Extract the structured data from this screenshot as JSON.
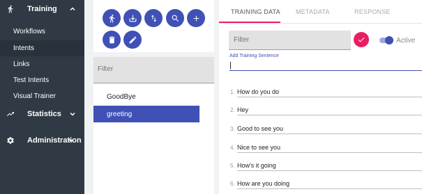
{
  "sidebar": {
    "training": {
      "label": "Training",
      "icon": "walk-icon",
      "chevron": "chevron-up-icon"
    },
    "items": [
      {
        "label": "Workflows"
      },
      {
        "label": "Intents",
        "active": true
      },
      {
        "label": "Links"
      },
      {
        "label": "Test Intents"
      },
      {
        "label": "Visual Trainer"
      }
    ],
    "statistics": {
      "label": "Statistics",
      "icon": "trending-up-icon",
      "chevron": "chevron-down-icon"
    },
    "administration": {
      "label": "Administration",
      "icon": "gear-icon",
      "chevron": "chevron-down-icon"
    }
  },
  "toolbar": {
    "buttons": [
      "walk-icon",
      "download-icon",
      "sort-icon",
      "search-icon",
      "add-icon",
      "delete-icon",
      "edit-icon"
    ]
  },
  "intents": {
    "filter_placeholder": "Filter",
    "items": [
      {
        "label": "GoodBye",
        "selected": false
      },
      {
        "label": "greeting",
        "selected": true
      }
    ]
  },
  "tabs": [
    {
      "label": "TRAINING DATA",
      "active": true
    },
    {
      "label": "METADATA",
      "active": false
    },
    {
      "label": "RESPONSE",
      "active": false
    }
  ],
  "training": {
    "filter_placeholder": "Filter",
    "active_label": "Active",
    "active": true,
    "add_label": "Add Training Sentence",
    "add_value": "",
    "sentences": [
      {
        "num": "1.",
        "text": "How do you do"
      },
      {
        "num": "2.",
        "text": "Hey"
      },
      {
        "num": "3.",
        "text": "Good to see you"
      },
      {
        "num": "4.",
        "text": "Nice to see you"
      },
      {
        "num": "5.",
        "text": "How's it going"
      },
      {
        "num": "6.",
        "text": "How are you doing"
      }
    ]
  },
  "colors": {
    "sidebar": "#2f3a44",
    "primary": "#3f51b5",
    "accent": "#e91e63"
  }
}
